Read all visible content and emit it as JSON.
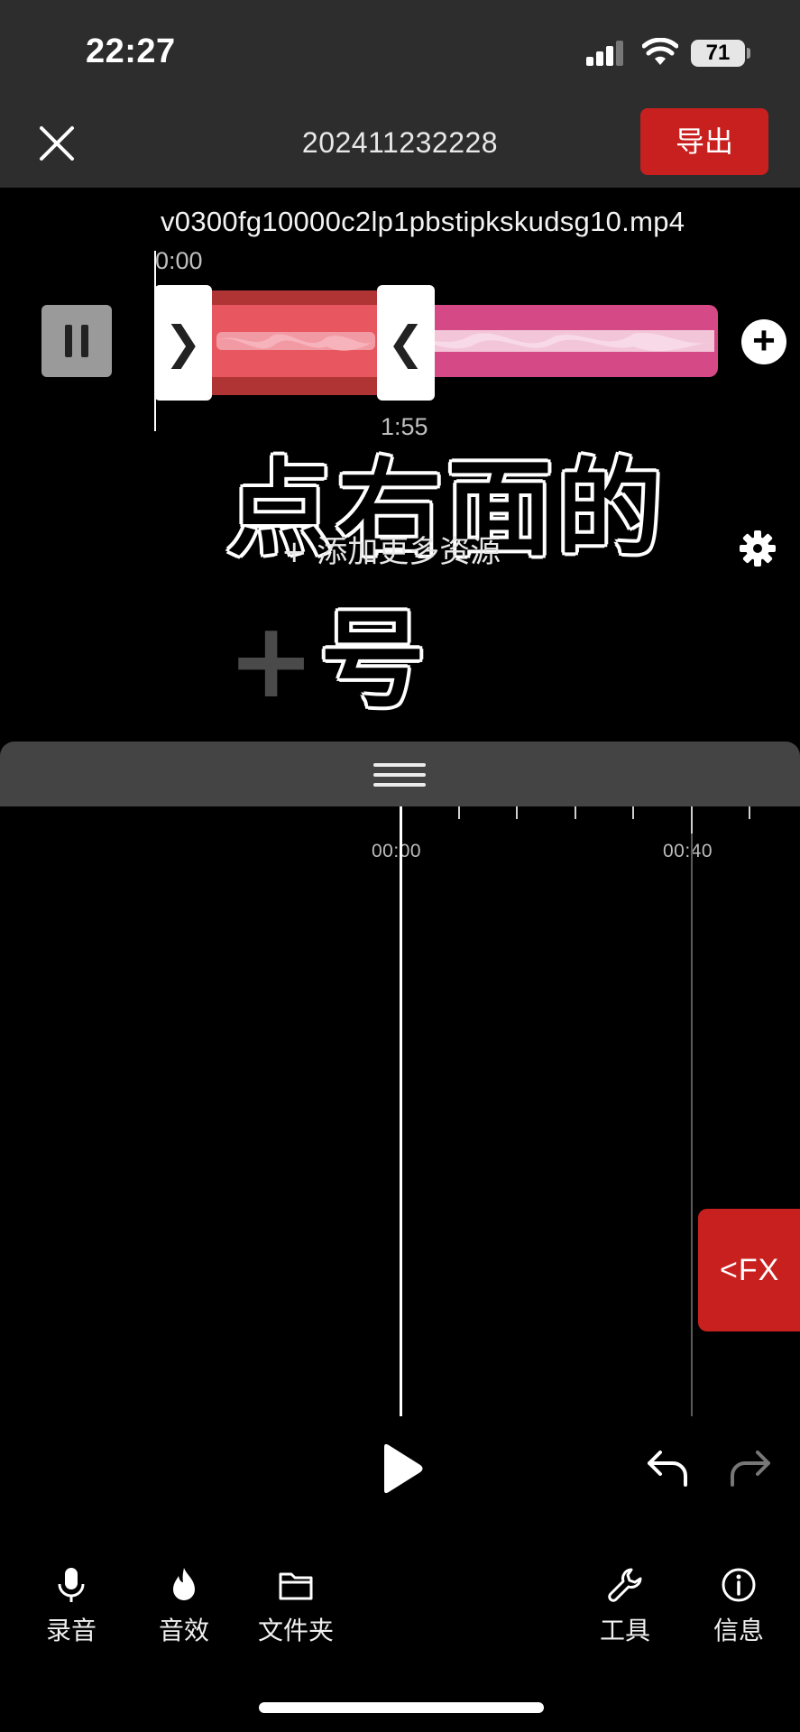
{
  "status_bar": {
    "time": "22:27",
    "battery": "71"
  },
  "header": {
    "title": "202411232228",
    "export_label": "导出"
  },
  "clip": {
    "file_name": "v0300fg10000c2lp1pbstipkskudsg10.mp4",
    "start_time": "0:00",
    "end_time": "1:55"
  },
  "overlay": {
    "caption_text": "点右面的",
    "caption_plus": "+",
    "caption_suffix": "号"
  },
  "add_more": {
    "label": "+ 添加更多资源"
  },
  "timeline": {
    "labels": [
      {
        "text": "00:00"
      },
      {
        "text": "00:40"
      }
    ]
  },
  "fx": {
    "label": "<FX"
  },
  "toolbar": {
    "items": [
      {
        "label": "录音",
        "icon": "microphone-icon"
      },
      {
        "label": "音效",
        "icon": "flame-icon"
      },
      {
        "label": "文件夹",
        "icon": "folder-icon"
      },
      {
        "label": "工具",
        "icon": "wrench-icon"
      },
      {
        "label": "信息",
        "icon": "info-icon"
      }
    ]
  },
  "colors": {
    "accent": "#c8201f",
    "clip_track": "#d54a86",
    "clip_selected": "#e8575f",
    "bar_background": "#2d2d2d"
  }
}
